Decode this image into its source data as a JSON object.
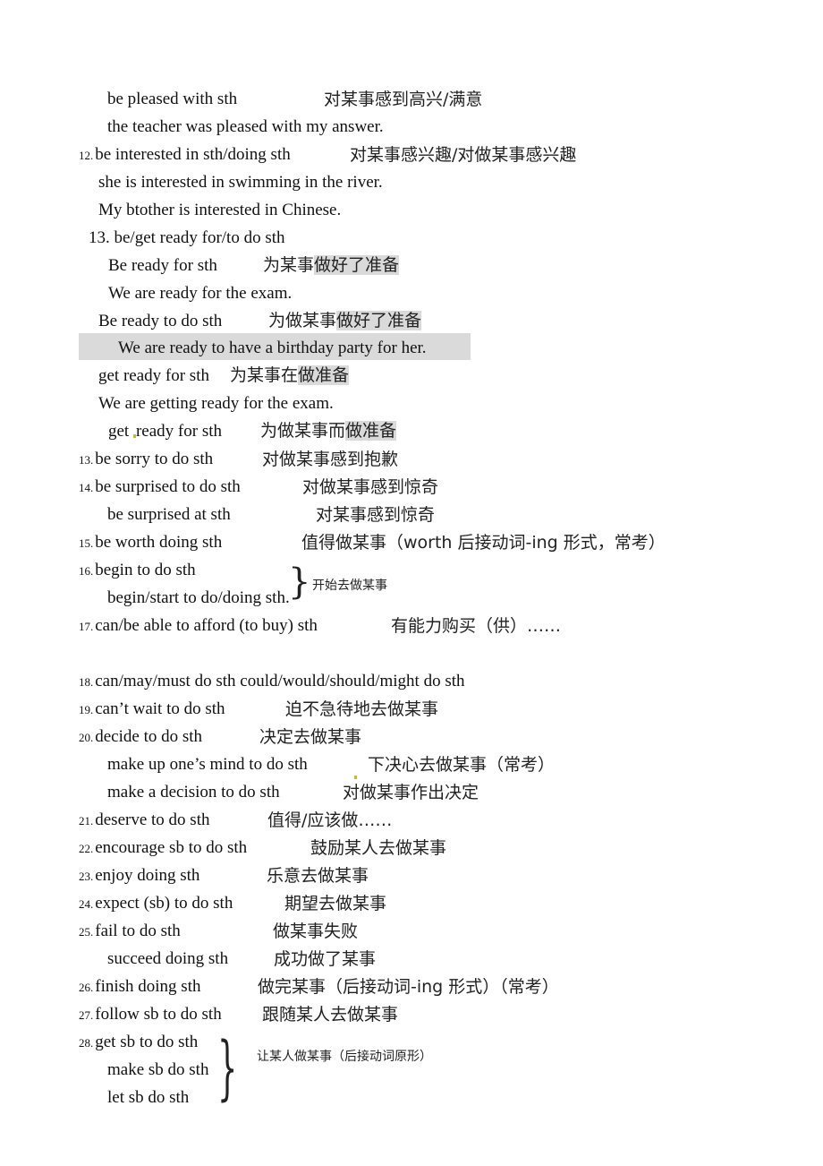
{
  "document": {
    "lines": [
      {
        "id": "l1",
        "en": "be pleased with sth",
        "zh": "对某事感到高兴/满意"
      },
      {
        "id": "l2",
        "en": "the teacher was pleased with my answer."
      },
      {
        "id": "l3",
        "num": "12.",
        "en": "be interested in sth/doing sth",
        "zh": "对某事感兴趣/对做某事感兴趣"
      },
      {
        "id": "l4",
        "en": "she is interested in swimming in the river."
      },
      {
        "id": "l5",
        "en": "My btother is interested in Chinese."
      },
      {
        "id": "l6",
        "num": "13.",
        "en": "be/get ready for/to do sth"
      },
      {
        "id": "l7",
        "en": "Be ready for sth",
        "zh_plain": "为某事",
        "zh_hl": "做好了准备"
      },
      {
        "id": "l8",
        "en": "We are ready for the exam."
      },
      {
        "id": "l9",
        "en": "Be ready to do sth",
        "zh_plain": "为做某事",
        "zh_hl": "做好了准备"
      },
      {
        "id": "l10",
        "en": "We are ready to have a birthday party for her."
      },
      {
        "id": "l11",
        "en": "get ready for sth",
        "zh_plain": "为某事在",
        "zh_hl": "做准备"
      },
      {
        "id": "l12",
        "en": "We are getting ready for the exam."
      },
      {
        "id": "l13",
        "en_a": "get",
        "en_b": "ready for sth",
        "zh_plain": "为做某事而",
        "zh_hl": "做准备"
      },
      {
        "id": "l14",
        "num": "13.",
        "en": "be sorry to do sth",
        "zh": "对做某事感到抱歉"
      },
      {
        "id": "l15",
        "num": "14.",
        "en": "be surprised to do sth",
        "zh": "对做某事感到惊奇"
      },
      {
        "id": "l16",
        "en": "be surprised at sth",
        "zh": "对某事感到惊奇"
      },
      {
        "id": "l17",
        "num": "15.",
        "en": "be worth doing sth",
        "zh": "值得做某事（worth  后接动词-ing 形式，常考）"
      },
      {
        "id": "l18",
        "num": "16.",
        "en": "begin to do sth"
      },
      {
        "id": "l19",
        "en": "begin/start to do/doing sth.",
        "brace_note": "开始去做某事"
      },
      {
        "id": "l20",
        "num": "17.",
        "en": "can/be able to afford (to buy) sth",
        "zh": "有能力购买（供）……"
      },
      {
        "id": "l21",
        "num": "18.",
        "en": "can/may/must do sth could/would/should/might do sth"
      },
      {
        "id": "l22",
        "num": "19.",
        "en": "can’t wait to do sth",
        "zh": "迫不急待地去做某事"
      },
      {
        "id": "l23",
        "num": "20.",
        "en": "decide to do sth",
        "zh": "决定去做某事"
      },
      {
        "id": "l24",
        "en": "make up one’s mind to do sth",
        "zh": "下决心去做某事（常考）"
      },
      {
        "id": "l25",
        "en": "make a decision to do sth",
        "zh": "对做某事作出决定"
      },
      {
        "id": "l26",
        "num": "21.",
        "en": "deserve to do sth",
        "zh": "值得/应该做……"
      },
      {
        "id": "l27",
        "num": "22.",
        "en": "encourage sb to do sth",
        "zh": "鼓励某人去做某事"
      },
      {
        "id": "l28",
        "num": "23.",
        "en": "enjoy doing sth",
        "zh": "乐意去做某事"
      },
      {
        "id": "l29",
        "num": "24.",
        "en": "expect (sb) to do sth",
        "zh": "期望去做某事"
      },
      {
        "id": "l30",
        "num": "25.",
        "en": "fail to do sth",
        "zh": "做某事失败"
      },
      {
        "id": "l31",
        "en": "succeed doing sth",
        "zh": "成功做了某事"
      },
      {
        "id": "l32",
        "num": "26.",
        "en": "finish doing sth",
        "zh": "做完某事（后接动词-ing 形式）（常考）"
      },
      {
        "id": "l33",
        "num": "27.",
        "en": "follow sb to do sth",
        "zh": "跟随某人去做某事"
      },
      {
        "id": "l34",
        "num": "28.",
        "en": "get sb to do sth"
      },
      {
        "id": "l35",
        "en": "make sb do sth",
        "brace_note": "让某人做某事（后接动词原形）"
      },
      {
        "id": "l36",
        "en": "let sb do sth"
      }
    ]
  }
}
